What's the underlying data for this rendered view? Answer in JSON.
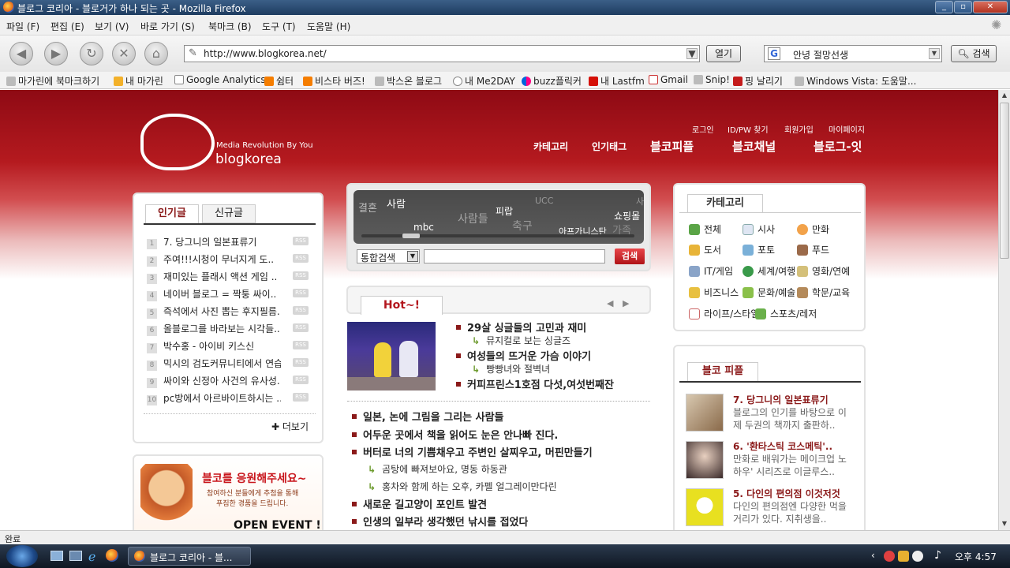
{
  "window": {
    "title": "블로그 코리아 - 블로거가 하나 되는 곳 - Mozilla Firefox"
  },
  "menu": [
    "파일 (F)",
    "편집 (E)",
    "보기 (V)",
    "바로 가기 (S)",
    "북마크 (B)",
    "도구 (T)",
    "도움말 (H)"
  ],
  "nav": {
    "url": "http://www.blogkorea.net/",
    "go_label": "열기",
    "search_value": "안녕 절망선생",
    "search_label": "검색",
    "search_engine": "G"
  },
  "bookmarks": [
    "마가린에 북마크하기",
    "내 마가린",
    "Google Analytics",
    "쉼터",
    "비스타 버즈!",
    "박스온 블로그",
    "내 Me2DAY",
    "buzz플릭커",
    "내 Lastfm",
    "Gmail",
    "Snip!",
    "핑 날리기",
    "Windows Vista: 도움말..."
  ],
  "site": {
    "logo": {
      "tagline": "Media Revolution By You",
      "name": "blogkorea"
    },
    "top_links": [
      "로그인",
      "ID/PW 찾기",
      "회원가입",
      "마이페이지"
    ],
    "main_nav": [
      "카테고리",
      "인기태그",
      "블코피플",
      "블코채널",
      "블로그-잇"
    ],
    "popular": {
      "tabs": [
        "인기글",
        "신규글"
      ],
      "items": [
        "7. 당그니의 일본표류기",
        "주여!!!시청이 무너지게 도..",
        "재미있는 플래시 액션 게임 ..",
        "네이버 블로그 = 짝퉁 싸이..",
        "즉석에서 사진 뽑는 후지필름..",
        "올블로그를 바라보는 시각들..",
        "박수홍 - 아이비 키스신",
        "믹시의 검도커뮤니티에서 연습..",
        "싸이와 신정아 사건의 유사성..",
        "pc방에서 아르바이트하시는 .."
      ],
      "more": "더보기"
    },
    "search": {
      "tags": [
        "결혼",
        "사람",
        "UCC",
        "사",
        "사람들",
        "피랍",
        "mbc",
        "축구",
        "쇼핑몰",
        "아프가니스탄",
        "가족"
      ],
      "select": "통합검색",
      "button": "검색"
    },
    "hot": {
      "title": "Hot~!",
      "items": [
        "29살 싱글들의 고민과 재미",
        "여성들의 뜨거운 가슴 이야기",
        "커피프린스1호점 다섯,여섯번째잔"
      ],
      "subs": [
        "뮤지컬로 보는 싱글즈",
        "빵빵녀와 절벽녀"
      ]
    },
    "list": {
      "items": [
        "일본, 논에 그림을 그리는 사람들",
        "어두운 곳에서 책을 읽어도 눈은 안나빠 진다.",
        "버터로 너의 기쁨채우고 주변인 살찌우고, 머핀만들기",
        "새로운 길고양이 포인트 발견",
        "인생의 일부라 생각했던 낚시를 접었다"
      ],
      "subs": [
        "곰탕에 빠져보아요, 명동 하동관",
        "홍차와 함께 하는 오후, 카펠 얼그레이만다린"
      ]
    },
    "event": {
      "title": "블코를 응원해주세요~",
      "desc1": "참여하신 분들에게 추첨을 통해",
      "desc2": "푸짐한 경품을 드립니다.",
      "label": "OPEN EVENT !!"
    },
    "categories": {
      "tab": "카테고리",
      "items": [
        "전체",
        "시사",
        "만화",
        "도서",
        "포토",
        "푸드",
        "IT/게임",
        "세계/여행",
        "영화/연예",
        "비즈니스",
        "문화/예술",
        "학문/교육",
        "라이프/스타일",
        "스포츠/레저"
      ]
    },
    "people": {
      "tab": "블코 피플",
      "items": [
        {
          "title": "7. 당그니의 일본표류기",
          "desc1": "블로그의 인기를 바탕으로 이",
          "desc2": "제 두권의 책까지 출판하.."
        },
        {
          "title": "6. '환타스틱 코스메틱'..",
          "desc1": "만화로 배워가는 메이크업 노",
          "desc2": "하우' 시리즈로 이글루스.."
        },
        {
          "title": "5. 다인의 편의점 이것저것",
          "desc1": "다인의 편의점엔 다양한 먹을",
          "desc2": "거리가 있다. 지취생을.."
        }
      ]
    }
  },
  "status": {
    "text": "완료"
  },
  "taskbar": {
    "task": "블로그 코리아 - 블...",
    "clock": "오후 4:57"
  },
  "colors": {
    "accent": "#b3161d",
    "banner_dark": "#8e0a14",
    "link": "#8b1a1a"
  }
}
